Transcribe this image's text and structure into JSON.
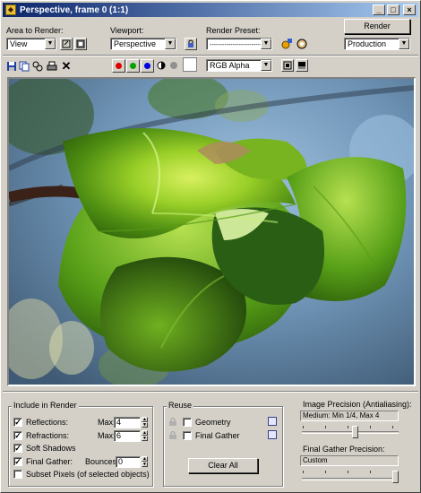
{
  "window": {
    "title": "Perspective, frame 0 (1:1)",
    "controls": [
      "minimize",
      "maximize",
      "close"
    ]
  },
  "toolbar": {
    "area_to_render_label": "Area to Render:",
    "area_to_render_value": "View",
    "viewport_label": "Viewport:",
    "viewport_value": "Perspective",
    "render_preset_label": "Render Preset:",
    "render_preset_value": "-----------------------------",
    "render_button": "Render",
    "production_value": "Production",
    "channel_value": "RGB Alpha",
    "channel_colors": {
      "red": "#e00000",
      "green": "#00a000",
      "blue": "#0000e0"
    }
  },
  "include_in_render": {
    "title": "Include in Render",
    "reflections": {
      "label": "Reflections:",
      "checked": true,
      "max_label": "Max:",
      "max_value": "4"
    },
    "refractions": {
      "label": "Refractions:",
      "checked": true,
      "max_label": "Max:",
      "max_value": "6"
    },
    "soft_shadows": {
      "label": "Soft Shadows",
      "checked": true
    },
    "final_gather": {
      "label": "Final Gather:",
      "checked": true,
      "bounces_label": "Bounces:",
      "bounces_value": "0"
    },
    "subset_pixels": {
      "label": "Subset Pixels (of selected objects)",
      "checked": false
    }
  },
  "reuse": {
    "title": "Reuse",
    "geometry": {
      "label": "Geometry",
      "checked": false
    },
    "final_gather": {
      "label": "Final Gather",
      "checked": false
    },
    "clear_all": "Clear All"
  },
  "image_precision": {
    "title": "Image Precision (Antialiasing):",
    "value": "Medium: Min 1/4, Max 4",
    "level": 0.55
  },
  "final_gather_precision": {
    "title": "Final Gather Precision:",
    "value": "Custom",
    "level": 1.0
  }
}
